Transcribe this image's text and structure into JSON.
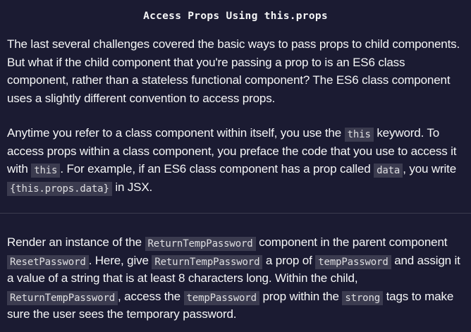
{
  "title": "Access Props Using this.props",
  "paragraphs": {
    "intro": {
      "text": "The last several challenges covered the basic ways to pass props to child components. But what if the child component that you're passing a prop to is an ES6 class component, rather than a stateless functional component? The ES6 class component uses a slightly different convention to access props."
    },
    "convention": {
      "t1": "Anytime you refer to a class component within itself, you use the ",
      "c1": "this",
      "t2": " keyword. To access props within a class component, you preface the code that you use to access it with ",
      "c2": "this",
      "t3": ". For example, if an ES6 class component has a prop called ",
      "c3": "data",
      "t4": ", you write ",
      "c4": "{this.props.data}",
      "t5": " in JSX."
    },
    "task": {
      "t1": "Render an instance of the ",
      "c1": "ReturnTempPassword",
      "t2": " component in the parent component ",
      "c2": "ResetPassword",
      "t3": ". Here, give ",
      "c3": "ReturnTempPassword",
      "t4": " a prop of ",
      "c4": "tempPassword",
      "t5": " and assign it a value of a string that is at least 8 characters long. Within the child, ",
      "c5": "ReturnTempPassword",
      "t6": ", access the ",
      "c6": "tempPassword",
      "t7": " prop within the ",
      "c7": "strong",
      "t8": " tags to make sure the user sees the temporary password."
    }
  }
}
